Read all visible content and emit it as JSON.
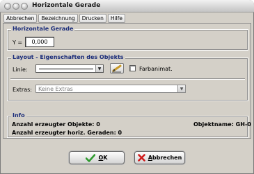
{
  "window": {
    "title": "Horizontale Gerade"
  },
  "menu": {
    "items": [
      {
        "label": "Abbrechen"
      },
      {
        "label": "Bezeichnung"
      },
      {
        "label": "Drucken"
      },
      {
        "label": "Hilfe"
      }
    ]
  },
  "gerade": {
    "title": "Horizontale Gerade",
    "y_label": "Y =",
    "y_value": "0,000"
  },
  "layout": {
    "title": "Layout - Eigenschaften des Objekts",
    "linie_label": "Linie:",
    "farbanimat_label": "Farbanimat.",
    "farbanimat_checked": false,
    "extras_label": "Extras:",
    "extras_value": "Keine Extras"
  },
  "info": {
    "title": "Info",
    "objects_created": "Anzahl erzeugter Objekte: 0",
    "objektname": "Objektname:  GH-0",
    "lines_created": "Anzahl erzeugter horiz. Geraden: 0"
  },
  "buttons": {
    "ok_prefix": "",
    "ok_underlined": "O",
    "ok_suffix": "K",
    "abbrechen_underlined": "A",
    "abbrechen_rest": "bbrechen"
  },
  "icons": {
    "ok": "checkmark-icon",
    "abbrechen": "cross-icon",
    "linie_tool": "pencil-icon"
  },
  "colors": {
    "group_title": "#1b2d7a",
    "ok_check": "#2e9a2e",
    "cancel_cross": "#d01a1a"
  }
}
